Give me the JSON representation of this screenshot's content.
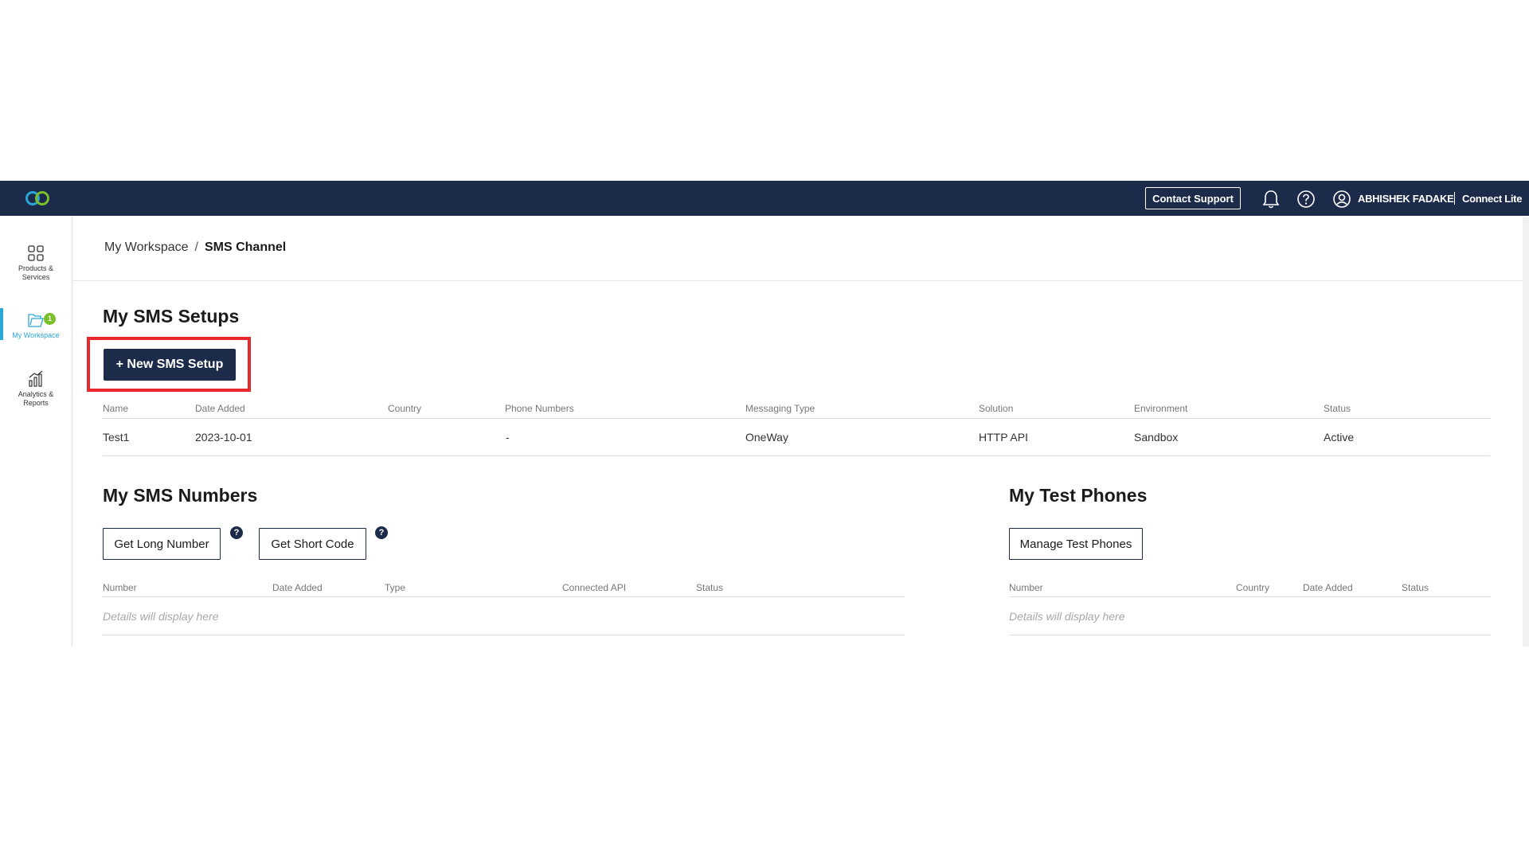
{
  "topbar": {
    "logo": "connect-logo",
    "contact_support": "Contact Support",
    "username": "ABHISHEK FADAKE",
    "product": "Connect Lite",
    "colors": {
      "bar": "#1d2b4b",
      "logo_teal": "#2aa6d9",
      "logo_green": "#7bbf2a"
    }
  },
  "leftnav": {
    "items": [
      {
        "label1": "Products &",
        "label2": "Services",
        "icon": "grid-icon"
      },
      {
        "label1": "My Workspace",
        "icon": "folder-icon",
        "badge": "1",
        "active": true
      },
      {
        "label1": "Analytics &",
        "label2": "Reports",
        "icon": "bar-chart-icon"
      }
    ],
    "active_color": "#2aa6d9"
  },
  "breadcrumb": {
    "parent": "My Workspace",
    "separator": "/",
    "current": "SMS Channel"
  },
  "setups": {
    "title": "My SMS Setups",
    "new_button": "+ New SMS Setup",
    "columns": [
      "Name",
      "Date Added",
      "Country",
      "Phone Numbers",
      "Messaging Type",
      "Solution",
      "Environment",
      "Status"
    ],
    "rows": [
      [
        "Test1",
        "2023-10-01",
        "",
        "-",
        "OneWay",
        "HTTP API",
        "Sandbox",
        "Active"
      ]
    ]
  },
  "numbers": {
    "title": "My SMS Numbers",
    "long_number_button": "Get Long Number",
    "short_code_button": "Get Short Code",
    "help": "?",
    "columns": [
      "Number",
      "Date Added",
      "Type",
      "Connected API",
      "Status"
    ],
    "empty": "Details will display here"
  },
  "test_phones": {
    "title": "My Test Phones",
    "manage_button": "Manage Test Phones",
    "columns": [
      "Number",
      "Country",
      "Date Added",
      "Status"
    ],
    "empty": "Details will display here"
  },
  "highlight_color": "#e8282b"
}
